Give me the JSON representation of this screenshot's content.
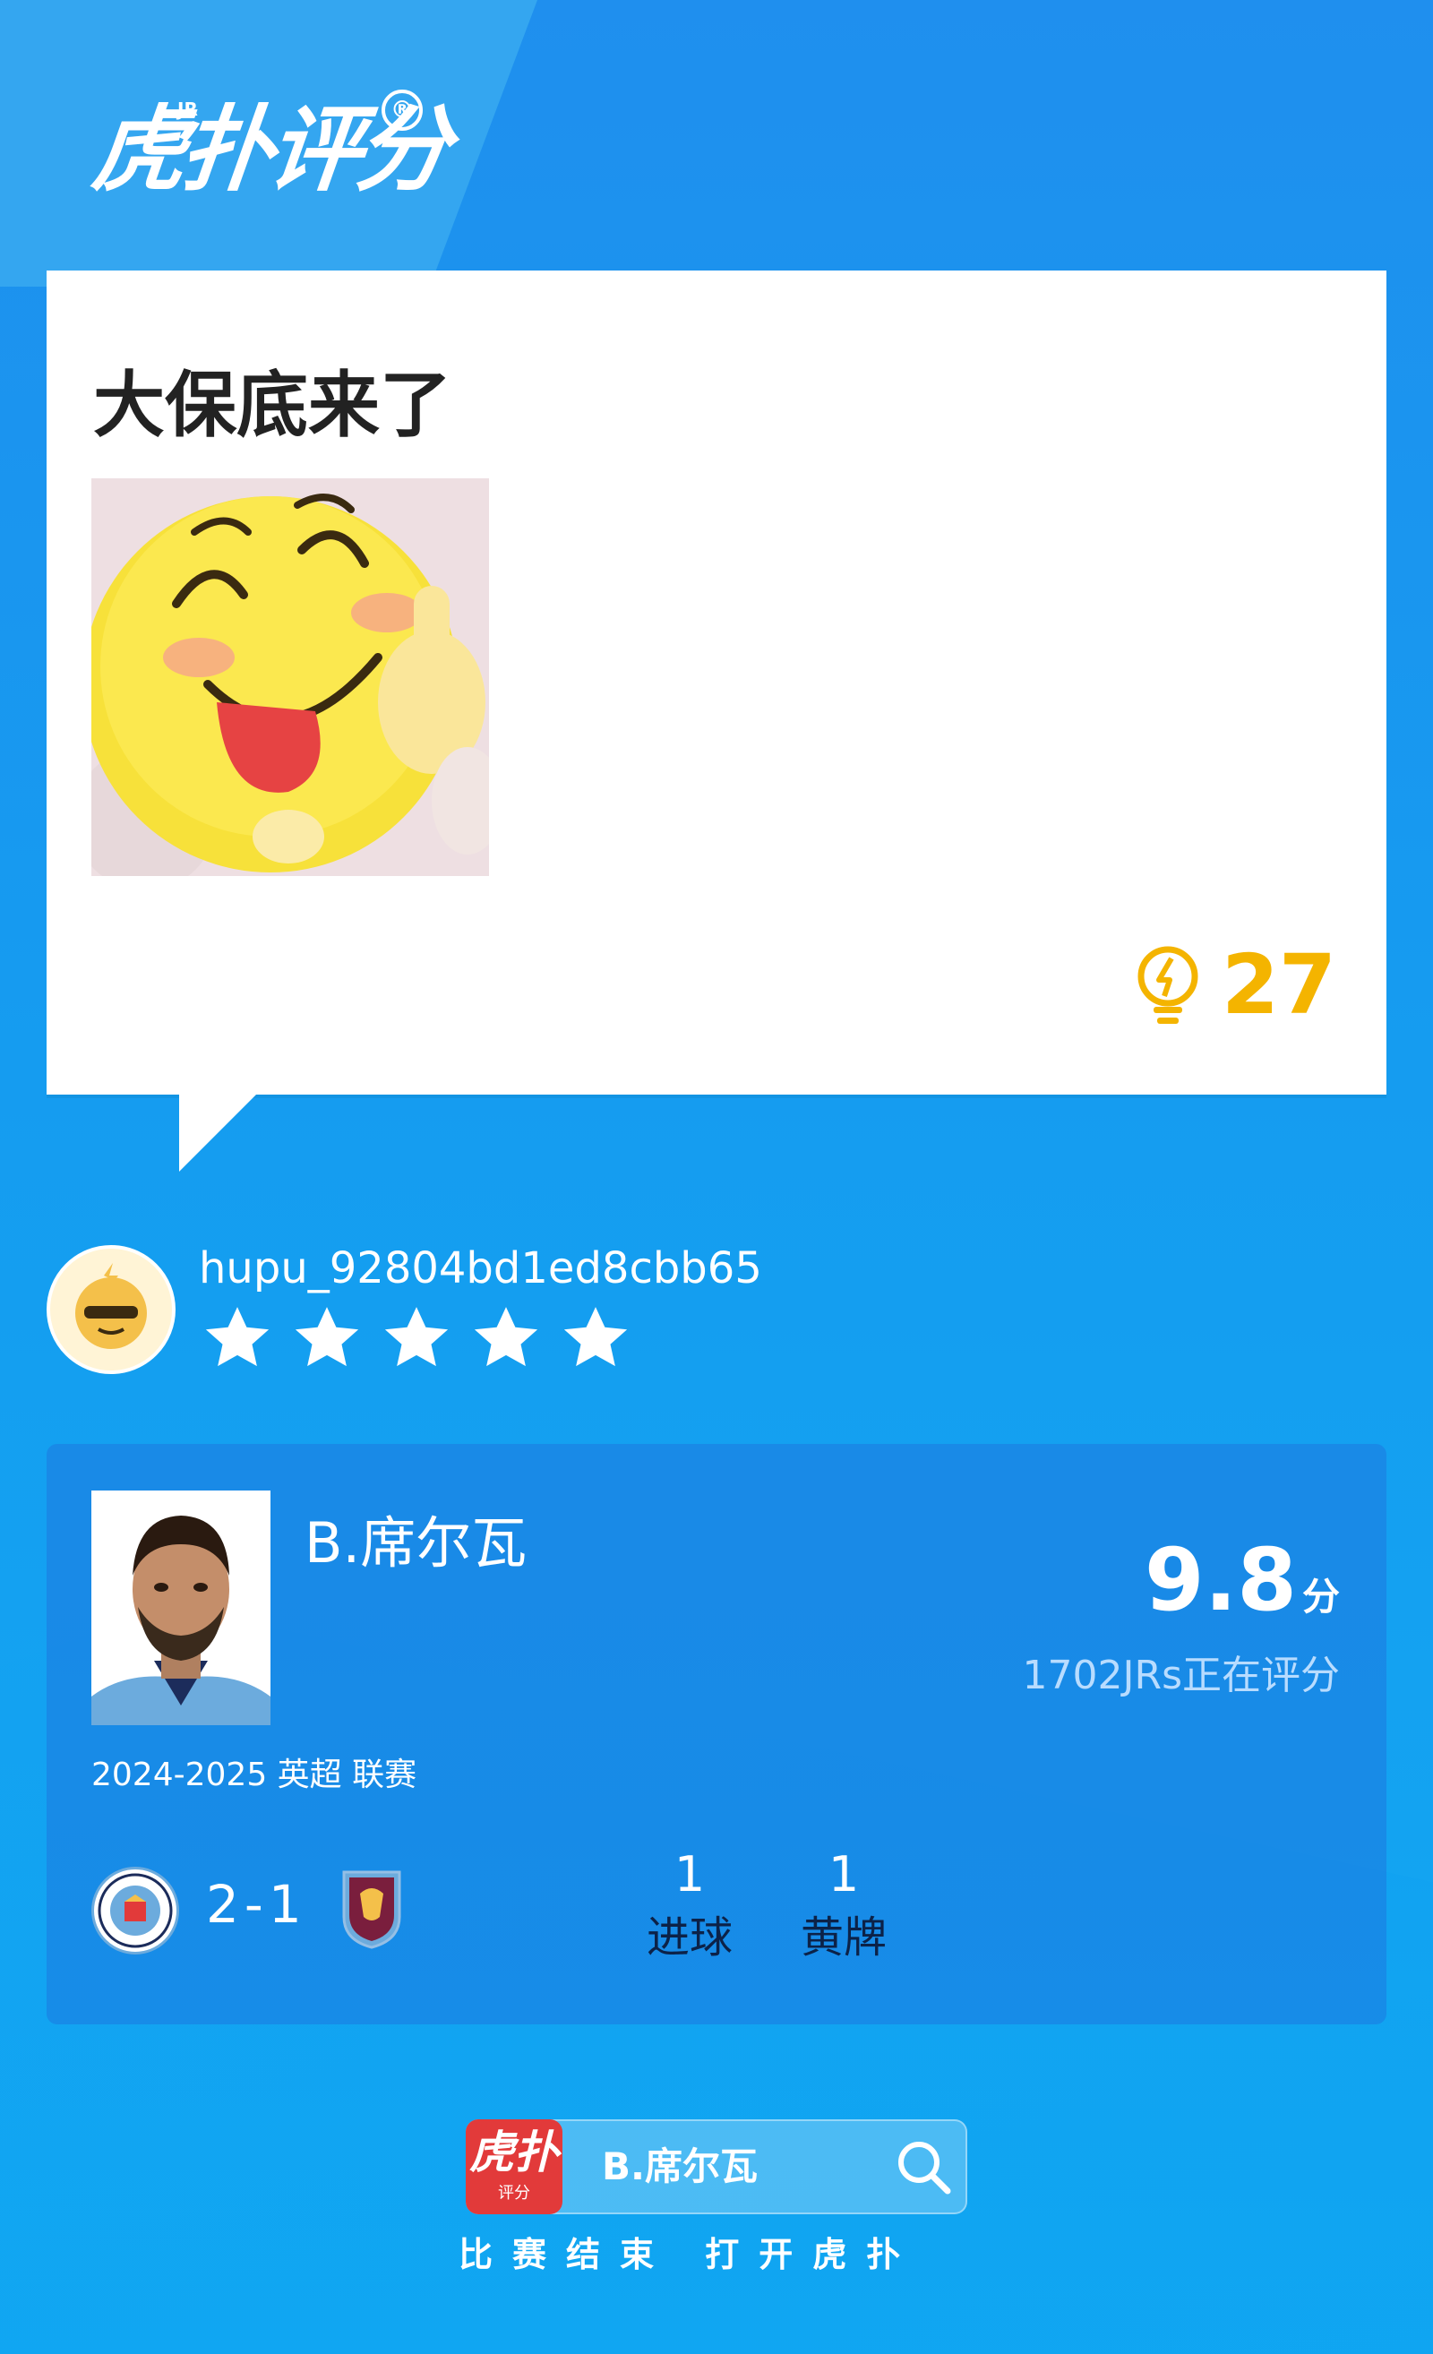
{
  "brand": {
    "logo_text": "虎扑评分",
    "logo_badge": "JR",
    "registered": "®"
  },
  "comment": {
    "text": "大保底来了",
    "like_count": "27",
    "image_icon": "grinning-thumbs-up-emoji"
  },
  "user": {
    "name": "hupu_92804bd1ed8cbb65",
    "stars": 5,
    "avatar_icon": "sunglasses-avatar-icon"
  },
  "player": {
    "name": "B.席尔瓦",
    "score": "9.8",
    "score_unit": "分",
    "raters": "1702JRs正在评分",
    "season": "2024-2025 英超 联赛"
  },
  "match": {
    "home_icon": "manchester-city-badge",
    "score": "2-1",
    "away_icon": "aston-villa-badge",
    "stats": [
      {
        "value": "1",
        "label": "进球"
      },
      {
        "value": "1",
        "label": "黄牌"
      }
    ]
  },
  "bottom": {
    "app_icon_main": "虎扑",
    "app_icon_sub": "评分",
    "search_text": "B.席尔瓦",
    "cta": "比赛结束 打开虎扑"
  },
  "colors": {
    "background": "#1f8fee",
    "like": "#f4b400",
    "white": "#ffffff",
    "label_dark": "#0c2248"
  }
}
